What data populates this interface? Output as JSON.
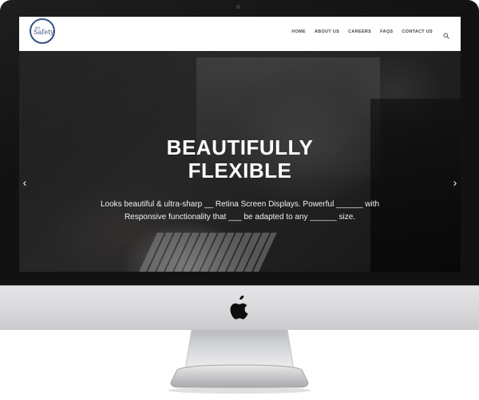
{
  "site": {
    "logo_small": "MA",
    "logo_main": "Safety"
  },
  "nav": {
    "items": [
      {
        "label": "HOME"
      },
      {
        "label": "ABOUT US"
      },
      {
        "label": "CAREERS"
      },
      {
        "label": "FAQS"
      },
      {
        "label": "CONTACT US"
      }
    ],
    "search_icon": "search-icon"
  },
  "hero": {
    "title": "BEAUTIFULLY\nFLEXIBLE",
    "text": "Looks beautiful & ultra-sharp __ Retina Screen Displays. Powerful ______ with Responsive functionality that ___ be adapted to any ______ size.",
    "prev_arrow": "‹",
    "next_arrow": "›"
  },
  "colors": {
    "logo_ring": "#2e4a7a",
    "nav_text": "#444444",
    "monitor_frame": "#121212",
    "chin": "#d6d7d9"
  }
}
